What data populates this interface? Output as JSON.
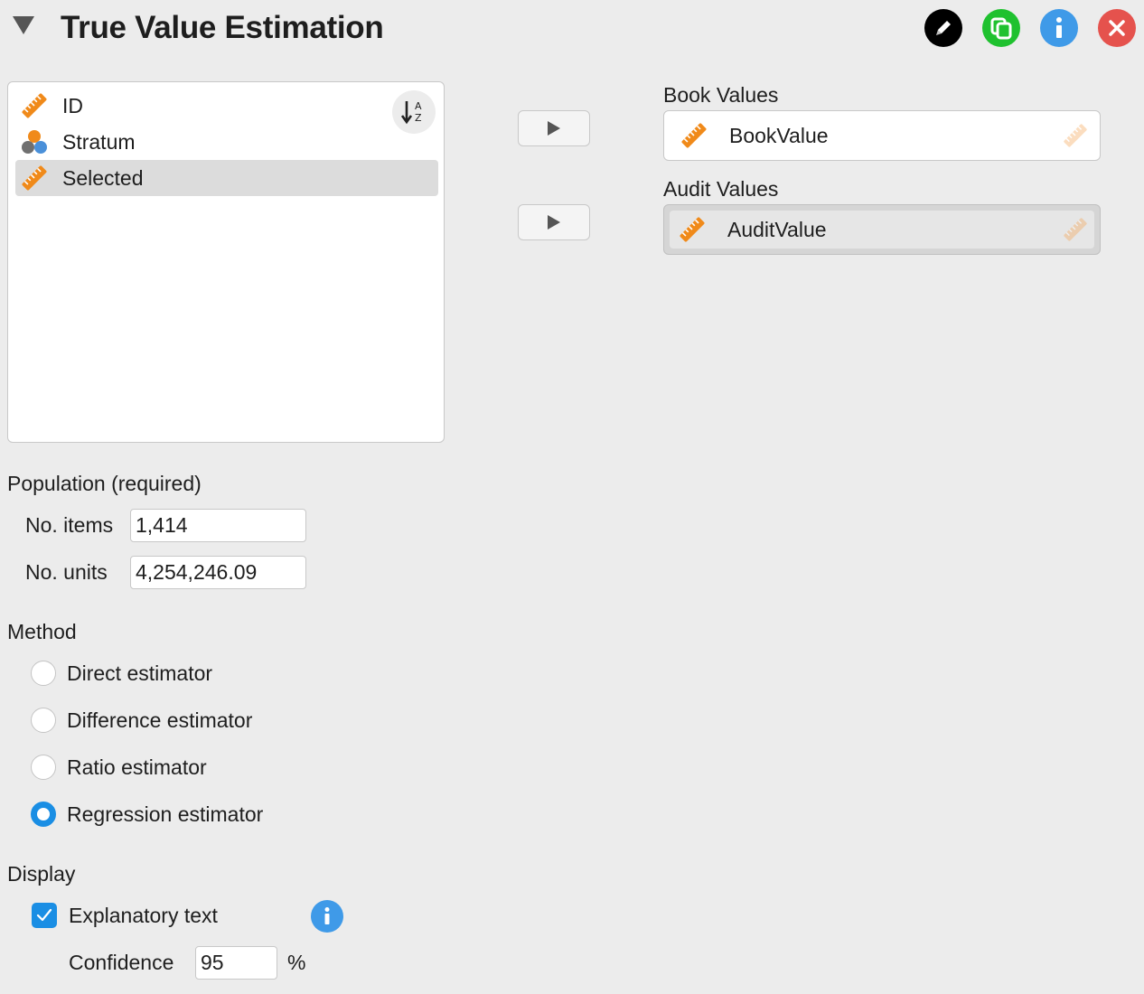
{
  "header": {
    "title": "True Value Estimation",
    "buttons": [
      {
        "name": "edit-title-button",
        "icon": "pencil-icon",
        "color": "#000000"
      },
      {
        "name": "duplicate-button",
        "icon": "copy-icon",
        "color": "#1fc12f"
      },
      {
        "name": "info-button",
        "icon": "info-icon",
        "color": "#3f9ae8"
      },
      {
        "name": "close-button",
        "icon": "close-icon",
        "color": "#e5524d"
      }
    ]
  },
  "variables": {
    "items": [
      {
        "label": "ID",
        "icon": "scale-ruler-icon",
        "selected": false
      },
      {
        "label": "Stratum",
        "icon": "nominal-circles-icon",
        "selected": false
      },
      {
        "label": "Selected",
        "icon": "scale-ruler-icon",
        "selected": true
      }
    ],
    "sort_icon": "sort-az-icon"
  },
  "book_values": {
    "label": "Book Values",
    "value": "BookValue"
  },
  "audit_values": {
    "label": "Audit Values",
    "value": "AuditValue"
  },
  "population": {
    "label": "Population (required)",
    "items_label": "No. items",
    "items_value": "1,414",
    "units_label": "No. units",
    "units_value": "4,254,246.09"
  },
  "method": {
    "label": "Method",
    "options": [
      {
        "label": "Direct estimator",
        "checked": false
      },
      {
        "label": "Difference estimator",
        "checked": false
      },
      {
        "label": "Ratio estimator",
        "checked": false
      },
      {
        "label": "Regression estimator",
        "checked": true
      }
    ]
  },
  "display": {
    "label": "Display",
    "explanatory_label": "Explanatory text",
    "explanatory_checked": true,
    "confidence_label": "Confidence",
    "confidence_value": "95",
    "confidence_unit": "%"
  },
  "colors": {
    "accent": "#1a8ee4",
    "scale_icon": "#f08a1a"
  }
}
